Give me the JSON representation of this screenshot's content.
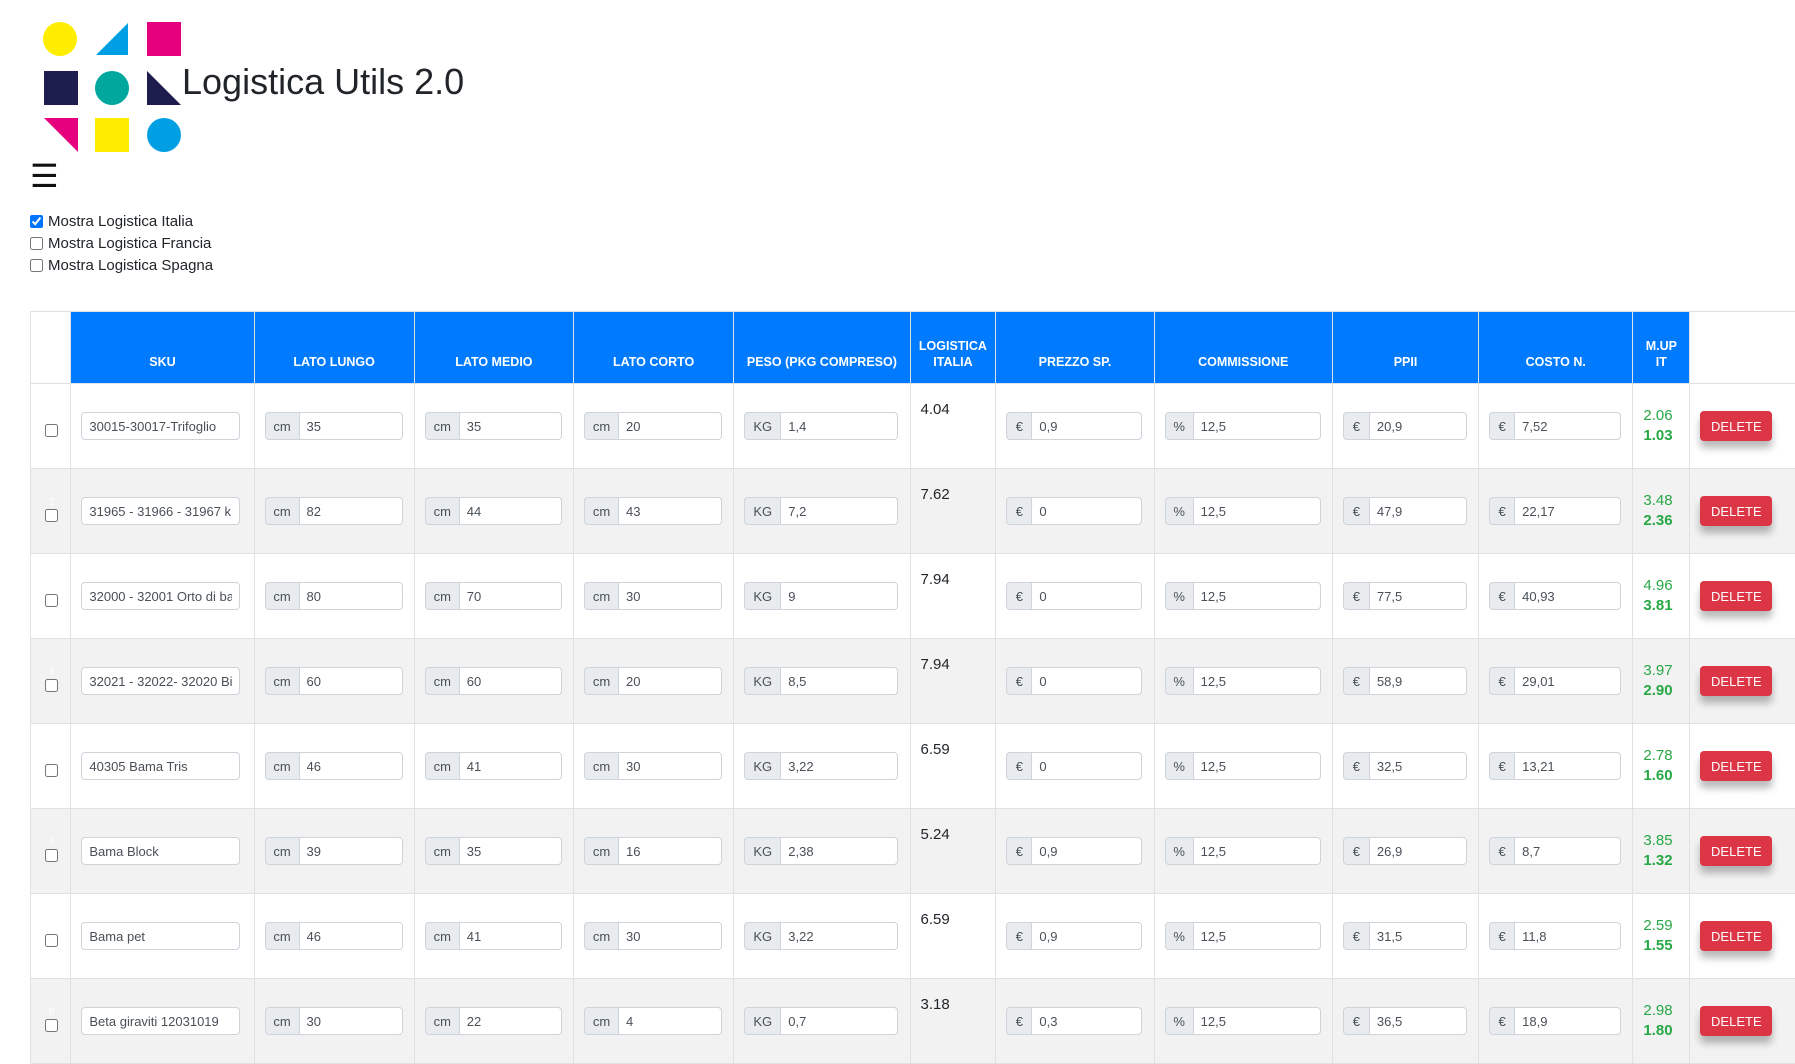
{
  "app": {
    "title": "Logistica Utils 2.0"
  },
  "colors": {
    "header_bg": "#007bff",
    "delete_bg": "#dc3545",
    "markup_green": "#28a745"
  },
  "menu": {
    "hamburger_icon": "☰"
  },
  "toggles": [
    {
      "label": "Mostra Logistica Italia",
      "checked": true
    },
    {
      "label": "Mostra Logistica Francia",
      "checked": false
    },
    {
      "label": "Mostra Logistica Spagna",
      "checked": false
    }
  ],
  "table": {
    "headers": {
      "sku": "SKU",
      "lato_lungo": "LATO LUNGO",
      "lato_medio": "LATO MEDIO",
      "lato_corto": "LATO CORTO",
      "peso": "PESO (PKG COMPRESO)",
      "logistica": "LOGISTICA ITALIA",
      "prezzo_sp": "PREZZO SP.",
      "commissione": "COMMISSIONE",
      "ppii": "PPII",
      "costo_n": "COSTO N.",
      "mup": "M.UP IT"
    },
    "prefix": {
      "cm": "cm",
      "kg": "KG",
      "euro": "€",
      "pct": "%"
    },
    "delete_label": "DELETE",
    "rows": [
      {
        "idx": "1",
        "sku": "30015-30017-Trifoglio",
        "lungo": "35",
        "medio": "35",
        "corto": "20",
        "peso": "1,4",
        "logistica": "4.04",
        "prezzo": "0,9",
        "commissione": "12,5",
        "ppii": "20,9",
        "costo": "7,52",
        "mup1": "2.06",
        "mup2": "1.03"
      },
      {
        "idx": "2",
        "sku": "31965 - 31966 - 31967 k",
        "lungo": "82",
        "medio": "44",
        "corto": "43",
        "peso": "7,2",
        "logistica": "7.62",
        "prezzo": "0",
        "commissione": "12,5",
        "ppii": "47,9",
        "costo": "22,17",
        "mup1": "3.48",
        "mup2": "2.36"
      },
      {
        "idx": "3",
        "sku": "32000 - 32001 Orto di ba",
        "lungo": "80",
        "medio": "70",
        "corto": "30",
        "peso": "9",
        "logistica": "7.94",
        "prezzo": "0",
        "commissione": "12,5",
        "ppii": "77,5",
        "costo": "40,93",
        "mup1": "4.96",
        "mup2": "3.81"
      },
      {
        "idx": "4",
        "sku": "32021 - 32022- 32020 Bi",
        "lungo": "60",
        "medio": "60",
        "corto": "20",
        "peso": "8,5",
        "logistica": "7.94",
        "prezzo": "0",
        "commissione": "12,5",
        "ppii": "58,9",
        "costo": "29,01",
        "mup1": "3.97",
        "mup2": "2.90"
      },
      {
        "idx": "5",
        "sku": "40305 Bama Tris",
        "lungo": "46",
        "medio": "41",
        "corto": "30",
        "peso": "3,22",
        "logistica": "6.59",
        "prezzo": "0",
        "commissione": "12,5",
        "ppii": "32,5",
        "costo": "13,21",
        "mup1": "2.78",
        "mup2": "1.60"
      },
      {
        "idx": "6",
        "sku": "Bama Block",
        "lungo": "39",
        "medio": "35",
        "corto": "16",
        "peso": "2,38",
        "logistica": "5.24",
        "prezzo": "0,9",
        "commissione": "12,5",
        "ppii": "26,9",
        "costo": "8,7",
        "mup1": "3.85",
        "mup2": "1.32"
      },
      {
        "idx": "7",
        "sku": "Bama pet",
        "lungo": "46",
        "medio": "41",
        "corto": "30",
        "peso": "3,22",
        "logistica": "6.59",
        "prezzo": "0,9",
        "commissione": "12,5",
        "ppii": "31,5",
        "costo": "11,8",
        "mup1": "2.59",
        "mup2": "1.55"
      },
      {
        "idx": "8",
        "sku": "Beta giraviti 12031019",
        "lungo": "30",
        "medio": "22",
        "corto": "4",
        "peso": "0,7",
        "logistica": "3.18",
        "prezzo": "0,3",
        "commissione": "12,5",
        "ppii": "36,5",
        "costo": "18,9",
        "mup1": "2.98",
        "mup2": "1.80"
      }
    ]
  }
}
